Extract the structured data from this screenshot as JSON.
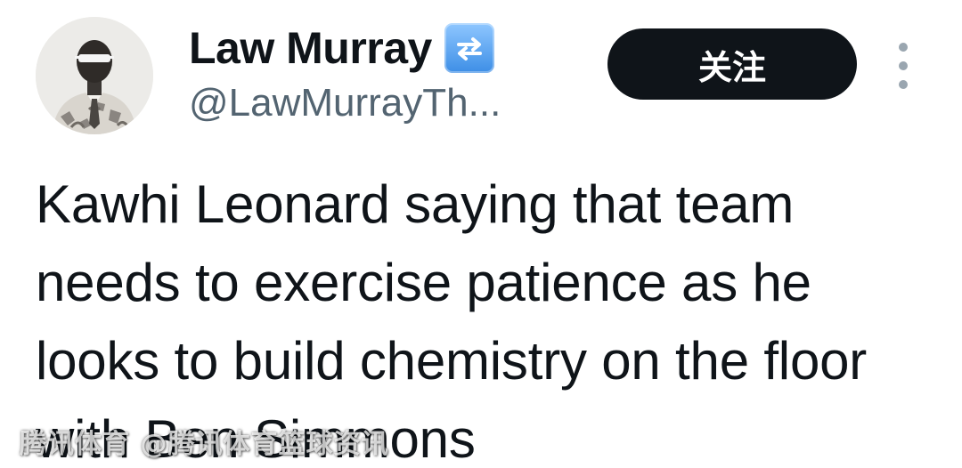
{
  "author": {
    "display_name": "Law Murray",
    "handle": "@LawMurrayTh...",
    "badge_icon": "repeat-arrows-icon",
    "avatar_icon": "profile-photo-avatar"
  },
  "actions": {
    "follow_label": "关注",
    "more_icon": "vertical-ellipsis-icon"
  },
  "tweet": {
    "text": "Kawhi Leonard saying that team needs to exercise patience as he looks to build chemistry on the floor with Ben Simmons"
  },
  "watermark": {
    "text": "腾讯体育 @腾讯体育篮球资讯"
  },
  "colors": {
    "text_primary": "#0f1419",
    "text_secondary": "#536471",
    "button_bg": "#0f1419",
    "button_text": "#ffffff",
    "badge_blue": "#3d8ee6"
  }
}
